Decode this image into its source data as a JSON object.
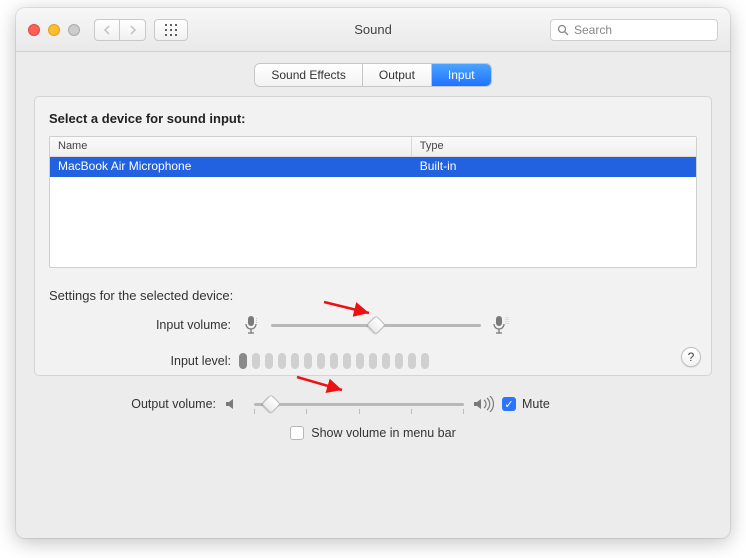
{
  "window": {
    "title": "Sound"
  },
  "search": {
    "placeholder": "Search"
  },
  "tabs": {
    "sound_effects": "Sound Effects",
    "output": "Output",
    "input": "Input"
  },
  "panel": {
    "section_title": "Select a device for sound input:",
    "columns": {
      "name": "Name",
      "type": "Type"
    },
    "devices": [
      {
        "name": "MacBook Air Microphone",
        "type": "Built-in"
      }
    ],
    "settings_label": "Settings for the selected device:",
    "input_volume_label": "Input volume:",
    "input_volume_percent": 50,
    "input_level_label": "Input level:",
    "input_level_active_bars": 1,
    "input_level_total_bars": 15
  },
  "output": {
    "volume_label": "Output volume:",
    "volume_percent": 8,
    "mute_label": "Mute",
    "mute_checked": true,
    "menubar_label": "Show volume in menu bar",
    "menubar_checked": false
  }
}
